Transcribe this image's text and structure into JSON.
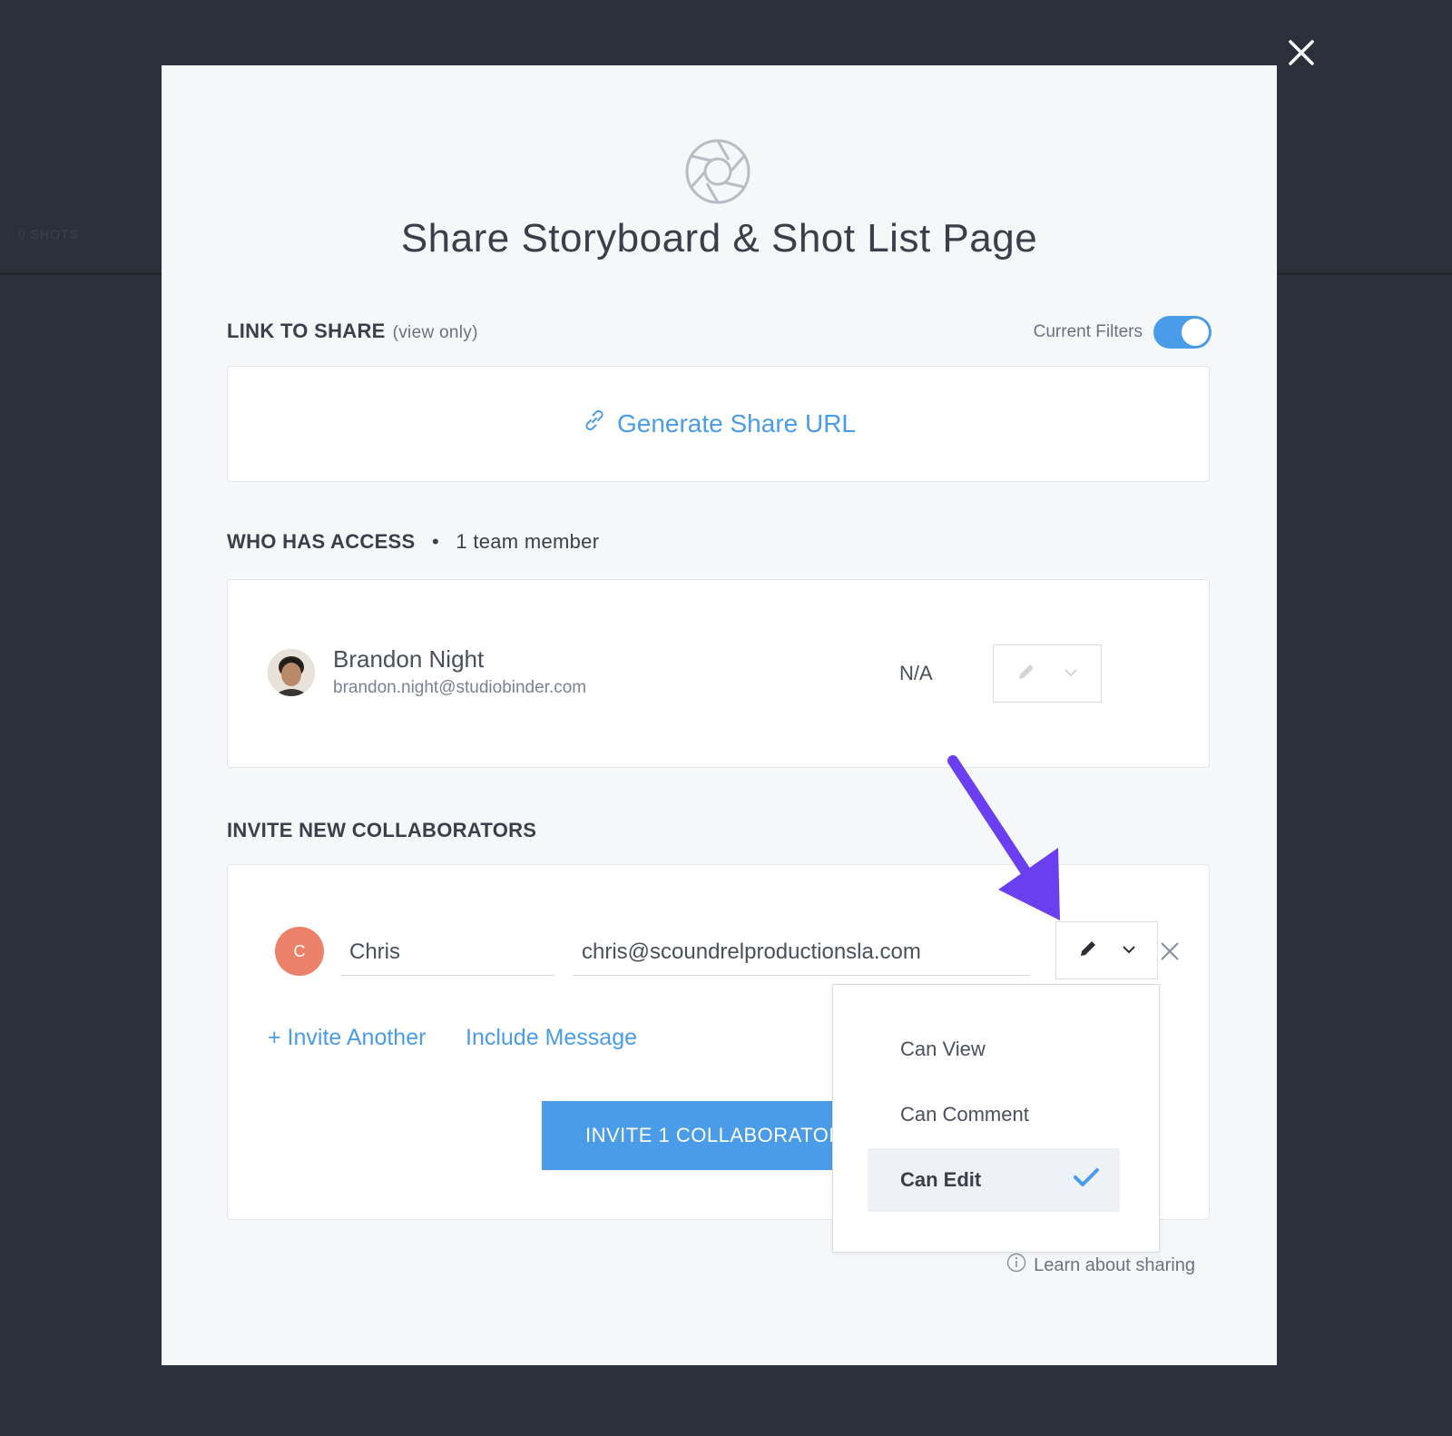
{
  "background": {
    "shots_label": "0 SHOTS"
  },
  "modal": {
    "title": "Share Storyboard & Shot List Page",
    "link_section": {
      "label": "LINK TO SHARE",
      "sub_label": "(view only)",
      "filters_label": "Current Filters",
      "filters_on": true,
      "generate_label": "Generate Share URL"
    },
    "access_section": {
      "label": "WHO HAS ACCESS",
      "separator": "•",
      "count_label": "1 team member",
      "member": {
        "name": "Brandon Night",
        "email": "brandon.night@studiobinder.com",
        "role": "N/A"
      }
    },
    "invite_section": {
      "label": "INVITE NEW COLLABORATORS",
      "avatar_initial": "C",
      "name_value": "Chris",
      "email_value": "chris@scoundrelproductionsla.com",
      "invite_another": "+ Invite Another",
      "include_message": "Include Message",
      "invite_button": "INVITE 1 COLLABORATOR"
    },
    "permission_dropdown": {
      "options": [
        "Can View",
        "Can Comment",
        "Can Edit"
      ],
      "selected": "Can Edit"
    },
    "learn_link": "Learn about sharing"
  },
  "colors": {
    "accent": "#4a9be8",
    "avatar": "#ec8068",
    "arrow": "#6a3ff0",
    "background": "#2b303b"
  }
}
